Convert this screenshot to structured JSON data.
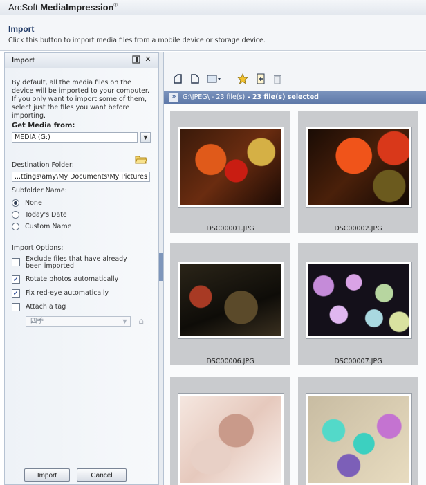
{
  "app": {
    "brand_regular": "ArcSoft ",
    "brand_bold": "MediaImpression",
    "brand_mark": "®"
  },
  "header": {
    "title": "Import",
    "description": "Click this button to import media files from a mobile device or storage device."
  },
  "panel": {
    "title": "Import",
    "intro": "By default, all the media files on the device will be imported to your computer. If you only want to import some of them, select just the files you want before importing.",
    "get_media_label": "Get Media from:",
    "media_source": "MEDIA (G:)",
    "destination_label": "Destination Folder:",
    "destination_path": "...ttings\\amy\\My Documents\\My Pictures",
    "subfolder_label": "Subfolder Name:",
    "subfolder_options": [
      "None",
      "Today's Date",
      "Custom Name"
    ],
    "subfolder_selected": "None",
    "import_options_label": "Import Options:",
    "options": [
      {
        "label": "Exclude files that have already been imported",
        "checked": false
      },
      {
        "label": "Rotate photos automatically",
        "checked": true
      },
      {
        "label": "Fix red-eye automatically",
        "checked": true
      },
      {
        "label": "Attach a tag",
        "checked": false
      }
    ],
    "tag_value": "四季",
    "import_button": "Import",
    "cancel_button": "Cancel"
  },
  "toolbar": {
    "icons": [
      "rotate-left-icon",
      "rotate-right-icon",
      "view-options-icon",
      "favorite-star-icon",
      "properties-icon",
      "delete-icon"
    ]
  },
  "selection_bar": {
    "path": "G:\\JPEG\\ - 23 file(s)",
    "selected": " - 23 file(s) selected"
  },
  "photos": [
    {
      "filename": "DSC00001.JPG"
    },
    {
      "filename": "DSC00002.JPG"
    },
    {
      "filename": "DSC00006.JPG"
    },
    {
      "filename": "DSC00007.JPG"
    },
    {
      "filename": ""
    },
    {
      "filename": ""
    }
  ],
  "colors": {
    "accent": "#5d78a8",
    "title_blue": "#1f3966"
  }
}
